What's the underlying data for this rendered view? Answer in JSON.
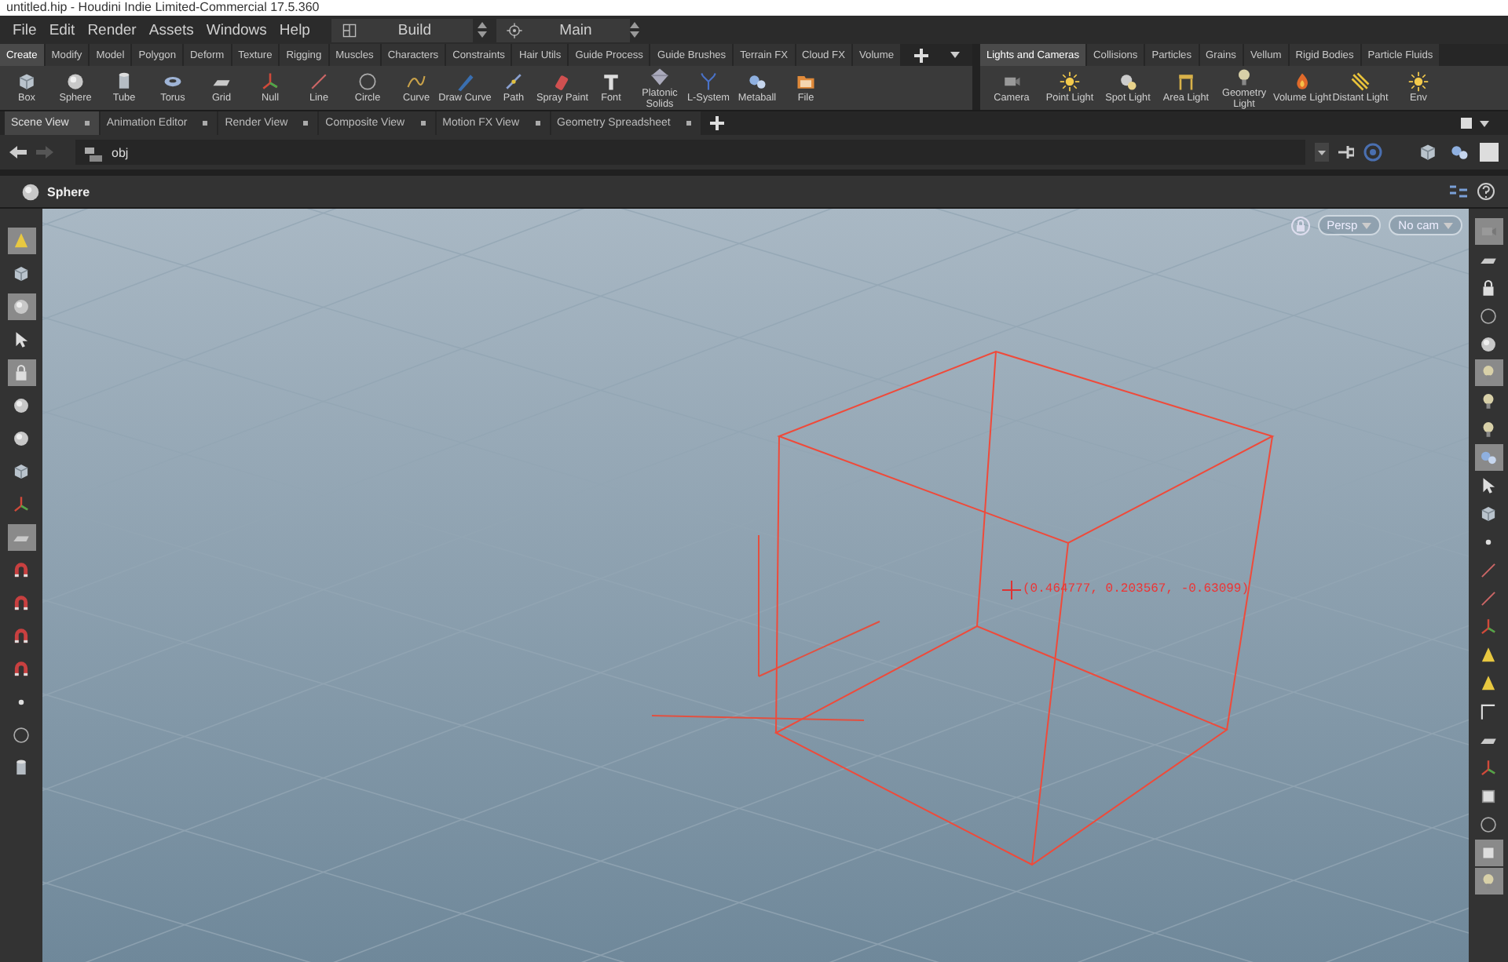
{
  "window": {
    "title": "untitled.hip - Houdini Indie Limited-Commercial 17.5.360"
  },
  "menu": [
    "File",
    "Edit",
    "Render",
    "Assets",
    "Windows",
    "Help"
  ],
  "desktops": [
    {
      "kind": "layout",
      "label": "Build"
    },
    {
      "kind": "target",
      "label": "Main"
    }
  ],
  "shelf_left": {
    "tabs": [
      {
        "label": "Create",
        "selected": true
      },
      {
        "label": "Modify",
        "selected": false
      },
      {
        "label": "Model",
        "selected": false
      },
      {
        "label": "Polygon",
        "selected": false
      },
      {
        "label": "Deform",
        "selected": false
      },
      {
        "label": "Texture",
        "selected": false
      },
      {
        "label": "Rigging",
        "selected": false
      },
      {
        "label": "Muscles",
        "selected": false
      },
      {
        "label": "Characters",
        "selected": false
      },
      {
        "label": "Constraints",
        "selected": false
      },
      {
        "label": "Hair Utils",
        "selected": false
      },
      {
        "label": "Guide Process",
        "selected": false
      },
      {
        "label": "Guide Brushes",
        "selected": false
      },
      {
        "label": "Terrain FX",
        "selected": false
      },
      {
        "label": "Cloud FX",
        "selected": false
      },
      {
        "label": "Volume",
        "selected": false
      }
    ],
    "tools": [
      {
        "label": "Box",
        "kind": "cube"
      },
      {
        "label": "Sphere",
        "kind": "sphere"
      },
      {
        "label": "Tube",
        "kind": "cylinder"
      },
      {
        "label": "Torus",
        "kind": "torus"
      },
      {
        "label": "Grid",
        "kind": "plane"
      },
      {
        "label": "Null",
        "kind": "axes"
      },
      {
        "label": "Line",
        "kind": "line"
      },
      {
        "label": "Circle",
        "kind": "circle"
      },
      {
        "label": "Curve",
        "kind": "curve"
      },
      {
        "label": "Draw Curve",
        "kind": "pen"
      },
      {
        "label": "Path",
        "kind": "path"
      },
      {
        "label": "Spray Paint",
        "kind": "spray"
      },
      {
        "label": "Font",
        "kind": "letter"
      },
      {
        "label": "Platonic\nSolids",
        "kind": "gem"
      },
      {
        "label": "L-System",
        "kind": "tree"
      },
      {
        "label": "Metaball",
        "kind": "blobs"
      },
      {
        "label": "File",
        "kind": "folder"
      }
    ]
  },
  "shelf_right": {
    "tabs": [
      {
        "label": "Lights and Cameras",
        "selected": true
      },
      {
        "label": "Collisions",
        "selected": false
      },
      {
        "label": "Particles",
        "selected": false
      },
      {
        "label": "Grains",
        "selected": false
      },
      {
        "label": "Vellum",
        "selected": false
      },
      {
        "label": "Rigid Bodies",
        "selected": false
      },
      {
        "label": "Particle Fluids",
        "selected": false
      }
    ],
    "tools": [
      {
        "label": "Camera",
        "kind": "camera"
      },
      {
        "label": "Point Light",
        "kind": "sun"
      },
      {
        "label": "Spot Light",
        "kind": "spot"
      },
      {
        "label": "Area Light",
        "kind": "stand"
      },
      {
        "label": "Geometry\nLight",
        "kind": "bulb"
      },
      {
        "label": "Volume Light",
        "kind": "flame"
      },
      {
        "label": "Distant Light",
        "kind": "burst"
      },
      {
        "label": "Env",
        "kind": "sun"
      }
    ]
  },
  "pane_tabs": [
    {
      "label": "Scene View",
      "selected": true
    },
    {
      "label": "Animation Editor",
      "selected": false
    },
    {
      "label": "Render View",
      "selected": false
    },
    {
      "label": "Composite View",
      "selected": false
    },
    {
      "label": "Motion FX View",
      "selected": false
    },
    {
      "label": "Geometry Spreadsheet",
      "selected": false
    }
  ],
  "path_bar": {
    "path": "obj"
  },
  "operation": {
    "name": "Sphere"
  },
  "left_toolbar": [
    {
      "kind": "cone",
      "selected": true
    },
    {
      "kind": "cube",
      "selected": false
    },
    {
      "kind": "sphere",
      "selected": true
    },
    {
      "kind": "pointer",
      "selected": false
    },
    {
      "kind": "lock",
      "selected": true
    },
    {
      "kind": "sphere",
      "selected": false
    },
    {
      "kind": "sphere",
      "selected": false
    },
    {
      "kind": "cube",
      "selected": false
    },
    {
      "kind": "axes",
      "selected": false
    },
    {
      "kind": "plane",
      "selected": true
    },
    {
      "kind": "magnet",
      "selected": false
    },
    {
      "kind": "magnet",
      "selected": false
    },
    {
      "kind": "magnet",
      "selected": false
    },
    {
      "kind": "magnet",
      "selected": false
    },
    {
      "kind": "dot",
      "selected": false
    },
    {
      "kind": "circle",
      "selected": false
    },
    {
      "kind": "cylinder",
      "selected": false
    }
  ],
  "viewport": {
    "view": "Persp",
    "camera": "No cam",
    "readout": "(0.464777, 0.203567, -0.63099)"
  },
  "right_toolbar": [
    {
      "kind": "camera",
      "selected": true
    },
    {
      "kind": "plane",
      "selected": false
    },
    {
      "kind": "lock",
      "selected": false
    },
    {
      "kind": "circle",
      "selected": false
    },
    {
      "kind": "sphere",
      "selected": false
    },
    {
      "kind": "bulb",
      "selected": true
    },
    {
      "kind": "bulb",
      "selected": false
    },
    {
      "kind": "bulb",
      "selected": false
    },
    {
      "kind": "blobs",
      "selected": true
    },
    {
      "kind": "pointer",
      "selected": false
    },
    {
      "kind": "cube",
      "selected": false
    },
    {
      "kind": "dot",
      "selected": false
    },
    {
      "kind": "line",
      "selected": false
    },
    {
      "kind": "line",
      "selected": false
    },
    {
      "kind": "axes",
      "selected": false
    },
    {
      "kind": "cone",
      "selected": false
    },
    {
      "kind": "cone",
      "selected": false
    },
    {
      "kind": "corner",
      "selected": false
    },
    {
      "kind": "plane",
      "selected": false
    },
    {
      "kind": "axes",
      "selected": false
    },
    {
      "kind": "square",
      "selected": false
    },
    {
      "kind": "circle",
      "selected": false
    },
    {
      "kind": "square",
      "selected": true
    },
    {
      "kind": "bulb",
      "selected": true
    }
  ]
}
